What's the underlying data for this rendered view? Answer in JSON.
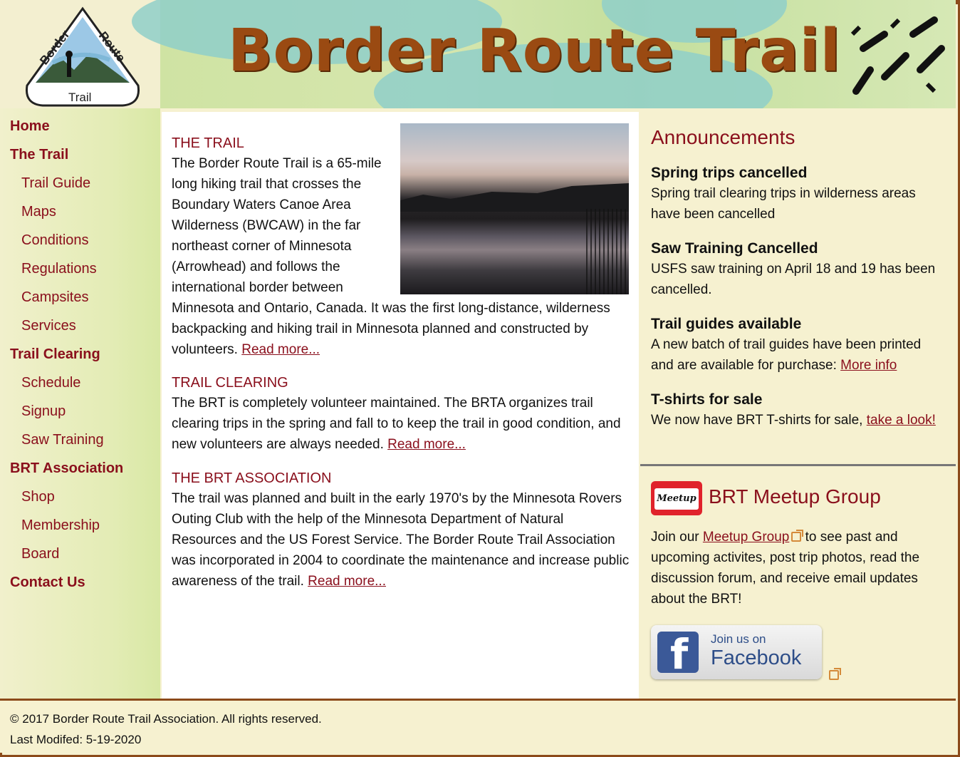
{
  "header": {
    "title": "Border Route Trail",
    "logo_words": [
      "Border",
      "Route",
      "Trail"
    ]
  },
  "nav": [
    {
      "label": "Home",
      "level": "top",
      "name": "nav-home"
    },
    {
      "label": "The Trail",
      "level": "top",
      "name": "nav-the-trail"
    },
    {
      "label": "Trail Guide",
      "level": "sub",
      "name": "nav-trail-guide"
    },
    {
      "label": "Maps",
      "level": "sub",
      "name": "nav-maps"
    },
    {
      "label": "Conditions",
      "level": "sub",
      "name": "nav-conditions"
    },
    {
      "label": "Regulations",
      "level": "sub",
      "name": "nav-regulations"
    },
    {
      "label": "Campsites",
      "level": "sub",
      "name": "nav-campsites"
    },
    {
      "label": "Services",
      "level": "sub",
      "name": "nav-services"
    },
    {
      "label": "Trail Clearing",
      "level": "top",
      "name": "nav-trail-clearing"
    },
    {
      "label": "Schedule",
      "level": "sub",
      "name": "nav-schedule"
    },
    {
      "label": "Signup",
      "level": "sub",
      "name": "nav-signup"
    },
    {
      "label": "Saw Training",
      "level": "sub",
      "name": "nav-saw-training"
    },
    {
      "label": "BRT Association",
      "level": "top",
      "name": "nav-brt-association"
    },
    {
      "label": "Shop",
      "level": "sub",
      "name": "nav-shop"
    },
    {
      "label": "Membership",
      "level": "sub",
      "name": "nav-membership"
    },
    {
      "label": "Board",
      "level": "sub",
      "name": "nav-board"
    },
    {
      "label": "Contact Us",
      "level": "top",
      "name": "nav-contact-us"
    }
  ],
  "main": {
    "sections": [
      {
        "title": "THE TRAIL",
        "text": "The Border Route Trail is a 65-mile long hiking trail that crosses the Boundary Waters Canoe Area Wilderness (BWCAW) in the far northeast corner of Minnesota (Arrowhead) and follows the international border between Minnesota and Ontario, Canada. It was the first long-distance, wilderness backpacking and hiking trail in Minnesota planned and constructed by volunteers.",
        "link": "Read more..."
      },
      {
        "title": "TRAIL CLEARING",
        "text": "The BRT is completely volunteer maintained. The BRTA organizes trail clearing trips in the spring and fall to to keep the trail in good condition, and new volunteers are always needed.",
        "link": "Read more..."
      },
      {
        "title": "THE BRT ASSOCIATION",
        "text": "The trail was planned and built in the early 1970's by the Minnesota Rovers Outing Club with the help of the Minnesota Department of Natural Resources and the US Forest Service. The Border Route Trail Association was incorporated in 2004 to coordinate the maintenance and increase public awareness of the trail.",
        "link": "Read more..."
      }
    ]
  },
  "announcements": {
    "title": "Announcements",
    "items": [
      {
        "heading": "Spring trips cancelled",
        "text": "Spring trail clearing trips in wilderness areas have been cancelled",
        "link": ""
      },
      {
        "heading": "Saw Training Cancelled",
        "text": "USFS saw training on April 18 and 19 has been cancelled.",
        "link": ""
      },
      {
        "heading": "Trail guides available",
        "text": "A new batch of trail guides have been printed and are available for purchase:",
        "link": "More info"
      },
      {
        "heading": "T-shirts for sale",
        "text": "We now have BRT T-shirts for sale,",
        "link": "take a look!"
      }
    ]
  },
  "meetup": {
    "logo_text": "Meetup",
    "title": "BRT Meetup Group",
    "text_before": "Join our",
    "link": "Meetup Group",
    "text_after": "to see past and upcoming activites, post trip photos, read the discussion forum, and receive email updates about the BRT!"
  },
  "facebook": {
    "line1": "Join us on",
    "line2": "Facebook",
    "logo_letter": "f"
  },
  "footer": {
    "copyright": "© 2017 Border Route Trail Association. All rights reserved.",
    "modified": "Last Modifed: 5-19-2020"
  },
  "colors": {
    "link": "#8a0f1c",
    "title": "#9a4a12",
    "border": "#8c4a1a",
    "background": "#f6f1d0"
  }
}
